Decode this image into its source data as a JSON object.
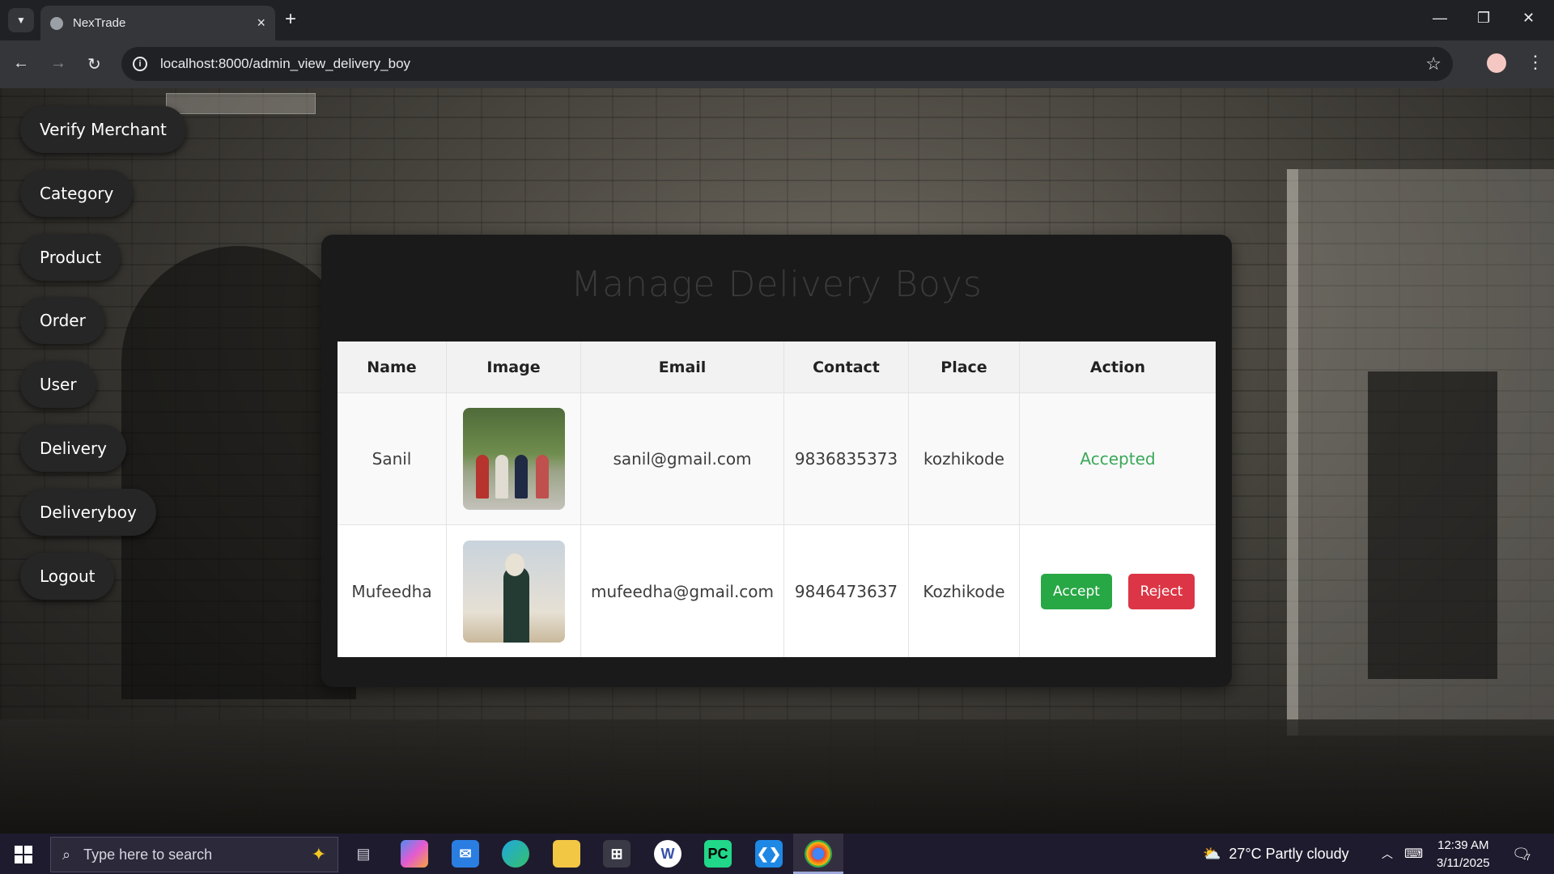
{
  "browser": {
    "tab_title": "NexTrade",
    "tab_close": "×",
    "new_tab": "+",
    "url": "localhost:8000/admin_view_delivery_boy",
    "window": {
      "minimize": "—",
      "restore": "❐",
      "close": "✕"
    }
  },
  "sidebar": {
    "items": [
      {
        "label": "Verify Merchant"
      },
      {
        "label": "Category"
      },
      {
        "label": "Product"
      },
      {
        "label": "Order"
      },
      {
        "label": "User"
      },
      {
        "label": "Delivery"
      },
      {
        "label": "Deliveryboy"
      },
      {
        "label": "Logout"
      }
    ]
  },
  "panel": {
    "title": "Manage Delivery Boys",
    "columns": [
      "Name",
      "Image",
      "Email",
      "Contact",
      "Place",
      "Action"
    ],
    "rows": [
      {
        "name": "Sanil",
        "email": "sanil@gmail.com",
        "contact": "9836835373",
        "place": "kozhikode",
        "status": "Accepted"
      },
      {
        "name": "Mufeedha",
        "email": "mufeedha@gmail.com",
        "contact": "9846473637",
        "place": "Kozhikode",
        "accept_label": "Accept",
        "reject_label": "Reject"
      }
    ]
  },
  "taskbar": {
    "search_placeholder": "Type here to search",
    "weather": "27°C  Partly cloudy",
    "time": "12:39 AM",
    "date": "3/11/2025",
    "notification_count": "7"
  },
  "colors": {
    "accepted": "#3aa85a",
    "accept_button": "#28a745",
    "reject_button": "#dc3545",
    "sidebar_button": "#262626"
  }
}
